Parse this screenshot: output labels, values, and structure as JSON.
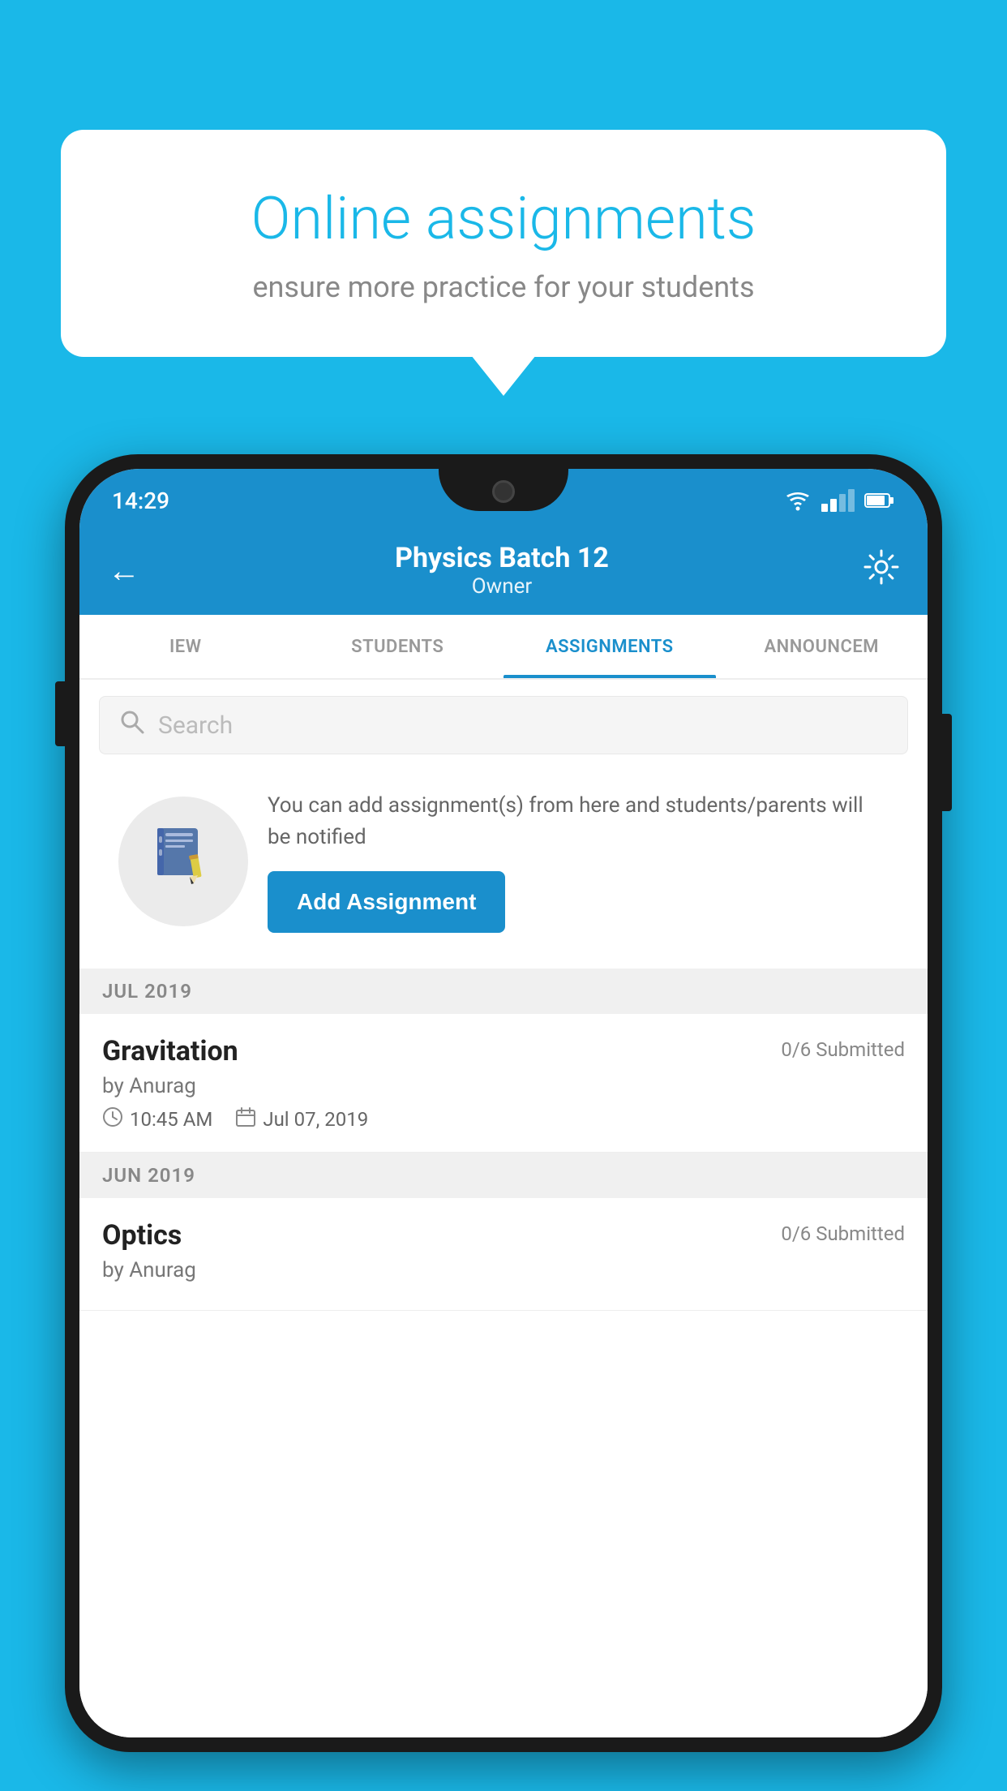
{
  "background_color": "#1ab8e8",
  "speech_bubble": {
    "title": "Online assignments",
    "subtitle": "ensure more practice for your students"
  },
  "status_bar": {
    "time": "14:29",
    "wifi": "▾",
    "battery": "▮"
  },
  "app_bar": {
    "title": "Physics Batch 12",
    "subtitle": "Owner",
    "back_icon": "←",
    "settings_icon": "⚙"
  },
  "tabs": [
    {
      "label": "IEW",
      "active": false
    },
    {
      "label": "STUDENTS",
      "active": false
    },
    {
      "label": "ASSIGNMENTS",
      "active": true
    },
    {
      "label": "ANNOUNCEM",
      "active": false
    }
  ],
  "search": {
    "placeholder": "Search"
  },
  "add_assignment_card": {
    "description": "You can add assignment(s) from here and students/parents will be notified",
    "button_label": "Add Assignment"
  },
  "month_sections": [
    {
      "label": "JUL 2019",
      "assignments": [
        {
          "name": "Gravitation",
          "submitted": "0/6 Submitted",
          "by": "by Anurag",
          "time": "10:45 AM",
          "date": "Jul 07, 2019"
        }
      ]
    },
    {
      "label": "JUN 2019",
      "assignments": [
        {
          "name": "Optics",
          "submitted": "0/6 Submitted",
          "by": "by Anurag",
          "time": "",
          "date": ""
        }
      ]
    }
  ]
}
